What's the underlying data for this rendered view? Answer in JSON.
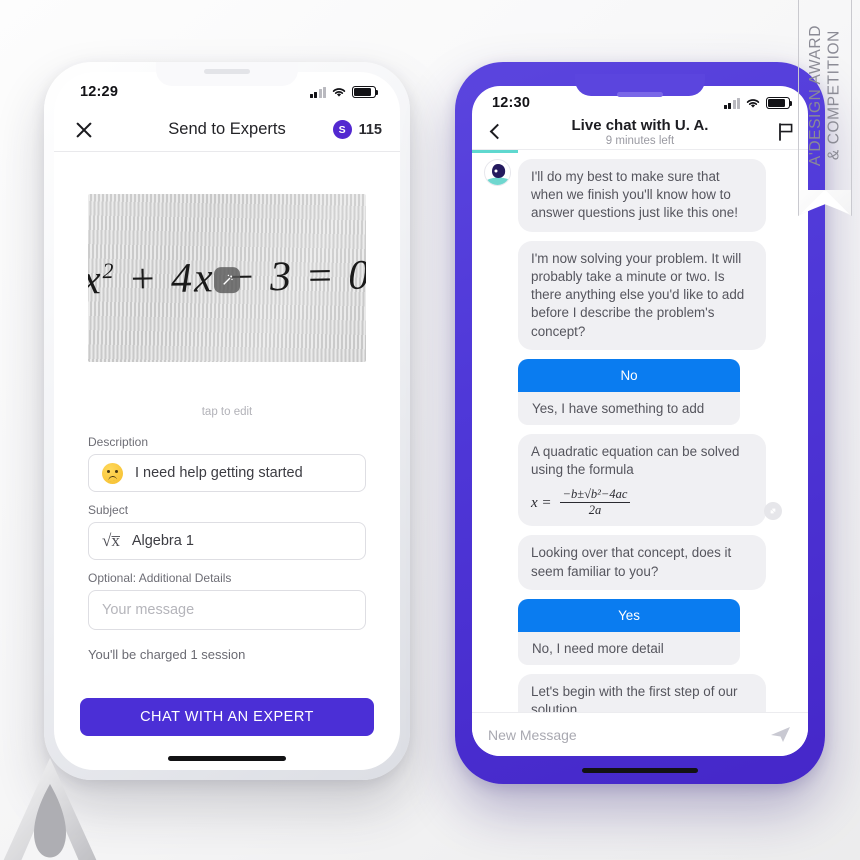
{
  "watermark": {
    "ribbon_text": "A'DESIGN AWARD\n& COMPETITION",
    "logo_name": "a-design-award-logo"
  },
  "left_phone": {
    "status_bar": {
      "time": "12:29",
      "signal_icon": "signal-bars-icon",
      "wifi_icon": "wifi-icon",
      "battery_icon": "battery-icon"
    },
    "app_bar": {
      "close_icon": "close-icon",
      "title": "Send to Experts",
      "credit_badge_letter": "S",
      "credit_count": "115"
    },
    "photo": {
      "equation_lhs": "x",
      "equation_sup": "2",
      "equation_rest": "+ 4x − 3 = 0",
      "edit_icon": "magic-wand-icon",
      "caption": "tap to edit"
    },
    "form": {
      "description_label": "Description",
      "description_value": "I need help getting started",
      "description_icon": "sad-face-emoji-icon",
      "subject_label": "Subject",
      "subject_value": "Algebra 1",
      "subject_icon": "square-root-icon",
      "details_label": "Optional: Additional Details",
      "details_placeholder": "Your message"
    },
    "charge_note": "You'll be charged 1 session",
    "cta_label": "CHAT WITH AN EXPERT"
  },
  "right_phone": {
    "status_bar": {
      "time": "12:30",
      "signal_icon": "signal-bars-icon",
      "wifi_icon": "wifi-icon",
      "battery_icon": "battery-icon"
    },
    "chat_bar": {
      "back_icon": "chevron-left-icon",
      "title": "Live chat with U. A.",
      "subtitle": "9 minutes left",
      "flag_icon": "flag-icon"
    },
    "messages": [
      {
        "type": "bubble",
        "avatar": true,
        "text": "I'll do my best to make sure that when we finish you'll know how to answer questions just like this one!"
      },
      {
        "type": "bubble",
        "avatar": false,
        "text": "I'm now solving your problem. It will probably take a minute or two. Is there anything else you'd like to add before I describe the problem's concept?"
      },
      {
        "type": "options",
        "selected": "No",
        "alternative": "Yes, I have something to add"
      },
      {
        "type": "formula",
        "text": "A quadratic equation can be solved using the formula",
        "formula_lhs": "x =",
        "numerator": "−b±√b²−4ac",
        "denominator": "2a",
        "expand_icon": "expand-icon"
      },
      {
        "type": "bubble",
        "avatar": false,
        "text": "Looking over that concept, does it seem familiar to you?"
      },
      {
        "type": "options",
        "selected": "Yes",
        "alternative": "No, I need more detail"
      },
      {
        "type": "bubble",
        "avatar": false,
        "text": "Let's begin with the first step of our solution."
      }
    ],
    "typing_indicator": {
      "avatar_icon": "expert-avatar-icon",
      "dots_icon": "typing-dots-icon"
    },
    "composer": {
      "placeholder": "New Message",
      "send_icon": "send-paper-plane-icon"
    }
  },
  "colors": {
    "brand_purple": "#4b2fd6",
    "phone_frame_purple": "#4f38d8",
    "option_blue": "#0a7cf0",
    "teal_accent": "#5fd8cf",
    "bubble_gray": "#f0f0f3"
  }
}
